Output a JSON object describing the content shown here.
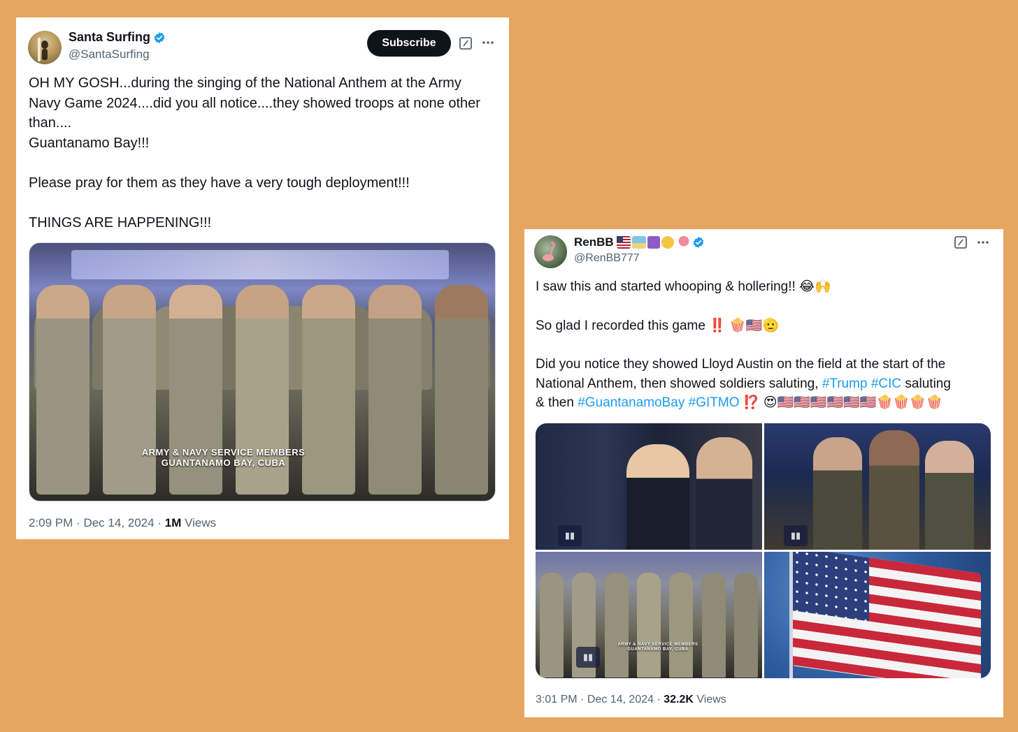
{
  "tweet1": {
    "display_name": "Santa Surfing",
    "handle": "@SantaSurfing",
    "subscribe_label": "Subscribe",
    "text_lines": [
      "OH MY GOSH...during the singing of the National Anthem at the Army",
      "Navy Game 2024....did you all notice....they showed troops at none other",
      "than....",
      "Guantanamo Bay!!!",
      "",
      "Please pray for them as they have a very tough deployment!!!",
      "",
      "THINGS ARE HAPPENING!!!"
    ],
    "image_caption_line1": "ARMY & NAVY SERVICE MEMBERS",
    "image_caption_line2": "GUANTANAMO BAY, CUBA",
    "time": "2:09 PM",
    "separator": "·",
    "date": "Dec 14, 2024",
    "views_count": "1M",
    "views_label": "Views"
  },
  "tweet2": {
    "display_name": "RenBB",
    "handle": "@RenBB777",
    "line1": "I saw this and started whooping & hollering!! 😂🙌",
    "line2": "So glad I recorded this game ‼️ 🍿🇺🇸🫡",
    "line3": "Did you notice they showed Lloyd Austin on the field at the start of the",
    "line4_a": "National Anthem, then showed soldiers saluting, ",
    "line4_tag1": "#Trump",
    "line4_tag2": "#CIC",
    "line4_b": " saluting",
    "line5_a": "& then ",
    "line5_tag1": "#GuantanamoBay",
    "line5_tag2": "#GITMO",
    "line5_b": " ⁉️ 😍🇺🇸🇺🇸🇺🇸🇺🇸🇺🇸🇺🇸🍿🍿🍿🍿",
    "mini_caption_line1": "ARMY & NAVY SERVICE MEMBERS",
    "mini_caption_line2": "GUANTANAMO BAY, CUBA",
    "time": "3:01 PM",
    "separator": "·",
    "date": "Dec 14, 2024",
    "views_count": "32.2K",
    "views_label": "Views"
  },
  "colors": {
    "background": "#e5a662",
    "hashtag": "#1d9bf0",
    "verified": "#1d9bf0",
    "muted_text": "#536471"
  },
  "icons": [
    "verified-badge-icon",
    "grok-icon",
    "more-icon",
    "play-icon"
  ]
}
